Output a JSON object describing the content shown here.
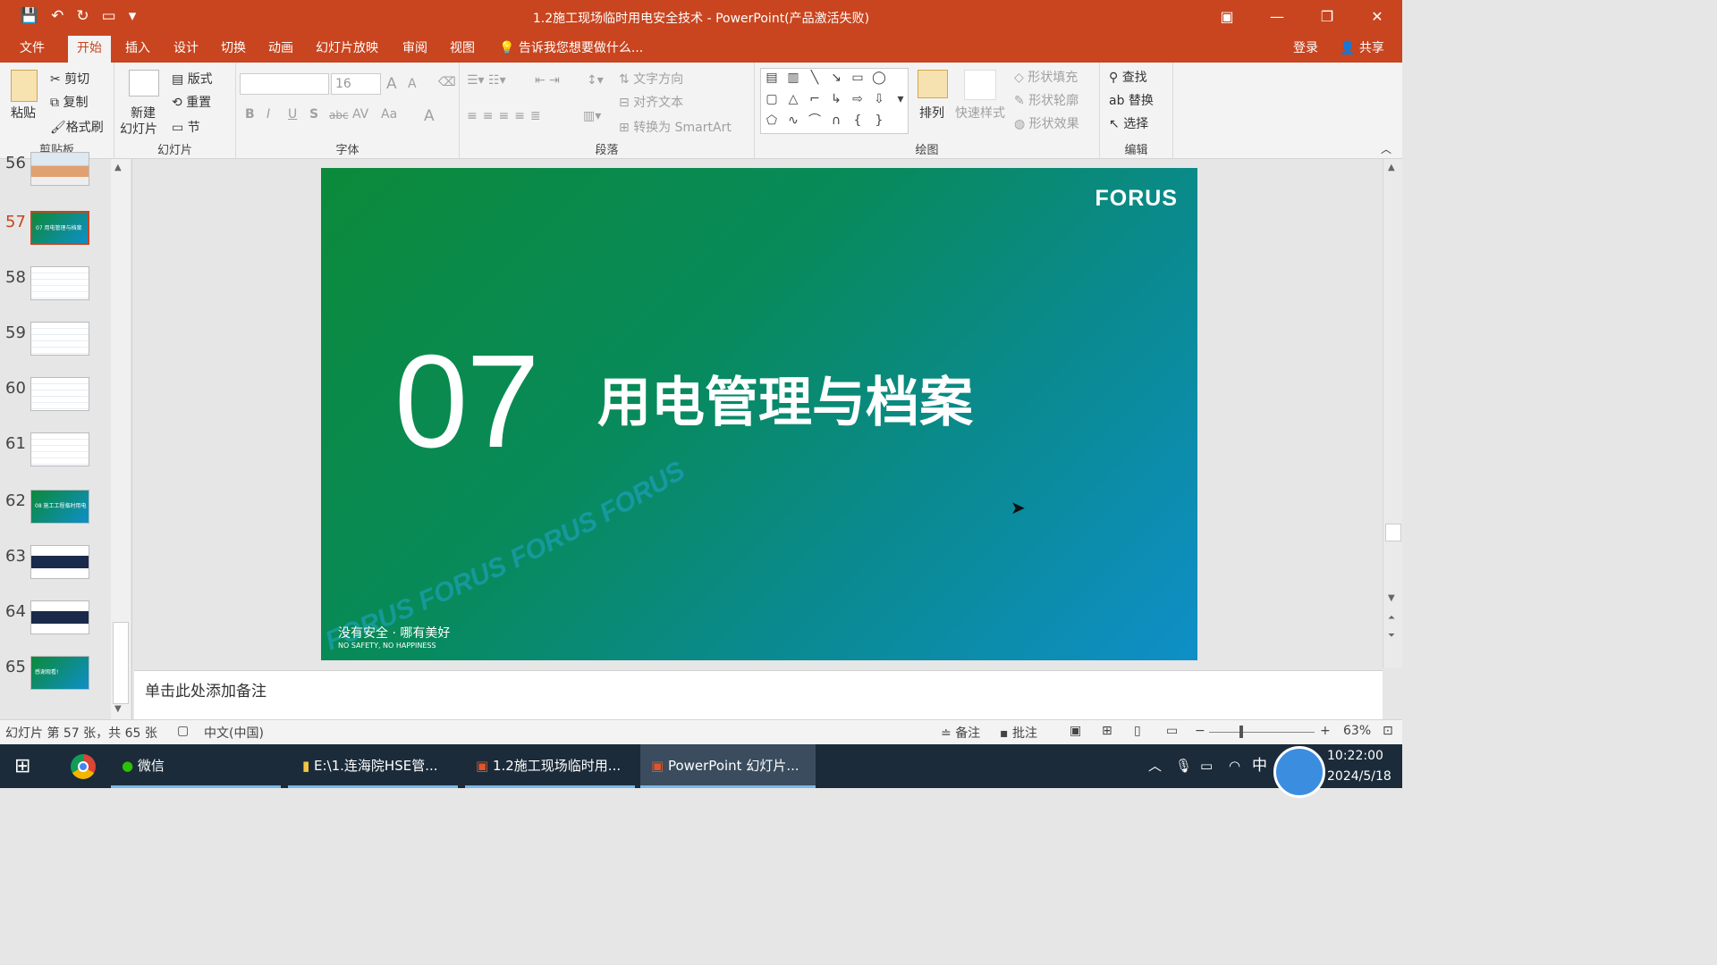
{
  "window": {
    "title": "1.2施工现场临时用电安全技术 - PowerPoint(产品激活失败)",
    "controls": [
      "▣",
      "—",
      "❐",
      "✕"
    ]
  },
  "qat": {
    "save": "💾",
    "undo": "↶",
    "redo": "↻",
    "present": "▭",
    "more": "▾"
  },
  "tabs": [
    "文件",
    "开始",
    "插入",
    "设计",
    "切换",
    "动画",
    "幻灯片放映",
    "审阅",
    "视图"
  ],
  "tell_me": "告诉我您想要做什么...",
  "signin": "登录",
  "share": "共享",
  "ribbon": {
    "clipboard": {
      "label": "剪贴板",
      "paste": "粘贴",
      "cut": "剪切",
      "copy": "复制",
      "format_painter": "格式刷"
    },
    "slides": {
      "label": "幻灯片",
      "new_slide": "新建",
      "new_slide2": "幻灯片",
      "layout": "版式",
      "reset": "重置",
      "section": "节"
    },
    "font": {
      "label": "字体",
      "font_name": "",
      "font_size": "16",
      "bold": "B",
      "italic": "I",
      "underline": "U",
      "shadow": "S",
      "strike": "abc",
      "spacing": "AV",
      "case": "Aa",
      "color": "A",
      "grow": "A",
      "shrink": "A"
    },
    "paragraph": {
      "label": "段落",
      "text_direction": "文字方向",
      "align_text": "对齐文本",
      "smartart": "转换为 SmartArt"
    },
    "drawing": {
      "label": "绘图",
      "arrange": "排列",
      "quick_styles": "快速样式",
      "shape_fill": "形状填充",
      "shape_outline": "形状轮廓",
      "shape_effects": "形状效果"
    },
    "editing": {
      "label": "编辑",
      "find": "查找",
      "replace": "替换",
      "select": "选择"
    }
  },
  "thumbnails": [
    {
      "num": "56",
      "selected": false,
      "style": "photo"
    },
    {
      "num": "57",
      "selected": true,
      "style": "green",
      "text": "07 用电管理与档案"
    },
    {
      "num": "58",
      "selected": false,
      "style": "white"
    },
    {
      "num": "59",
      "selected": false,
      "style": "white"
    },
    {
      "num": "60",
      "selected": false,
      "style": "white"
    },
    {
      "num": "61",
      "selected": false,
      "style": "white"
    },
    {
      "num": "62",
      "selected": false,
      "style": "green",
      "text": "08 施工工程临时用电"
    },
    {
      "num": "63",
      "selected": false,
      "style": "dark"
    },
    {
      "num": "64",
      "selected": false,
      "style": "dark"
    },
    {
      "num": "65",
      "selected": false,
      "style": "green",
      "text": "感谢观看!"
    }
  ],
  "slide": {
    "logo": "FORUS",
    "number": "07",
    "title": "用电管理与档案",
    "footer_cn": "没有安全 · 哪有美好",
    "footer_en": "NO SAFETY, NO HAPPINESS",
    "watermark": "FORUS FORUS FORUS FORUS"
  },
  "notes_placeholder": "单击此处添加备注",
  "status": {
    "slide_info": "幻灯片 第 57 张，共 65 张",
    "language": "中文(中国)",
    "notes": "备注",
    "comments": "批注",
    "zoom": "63%"
  },
  "taskbar": {
    "items": [
      "微信",
      "E:\\1.连海院HSE管...",
      "1.2施工现场临时用...",
      "PowerPoint 幻灯片..."
    ],
    "ime": "中",
    "time": "10:22:00",
    "date": "2024/5/18"
  },
  "colors": {
    "accent": "#c8451f",
    "slide_green": "#0c8a3a",
    "slide_blue": "#0e8fc8"
  }
}
